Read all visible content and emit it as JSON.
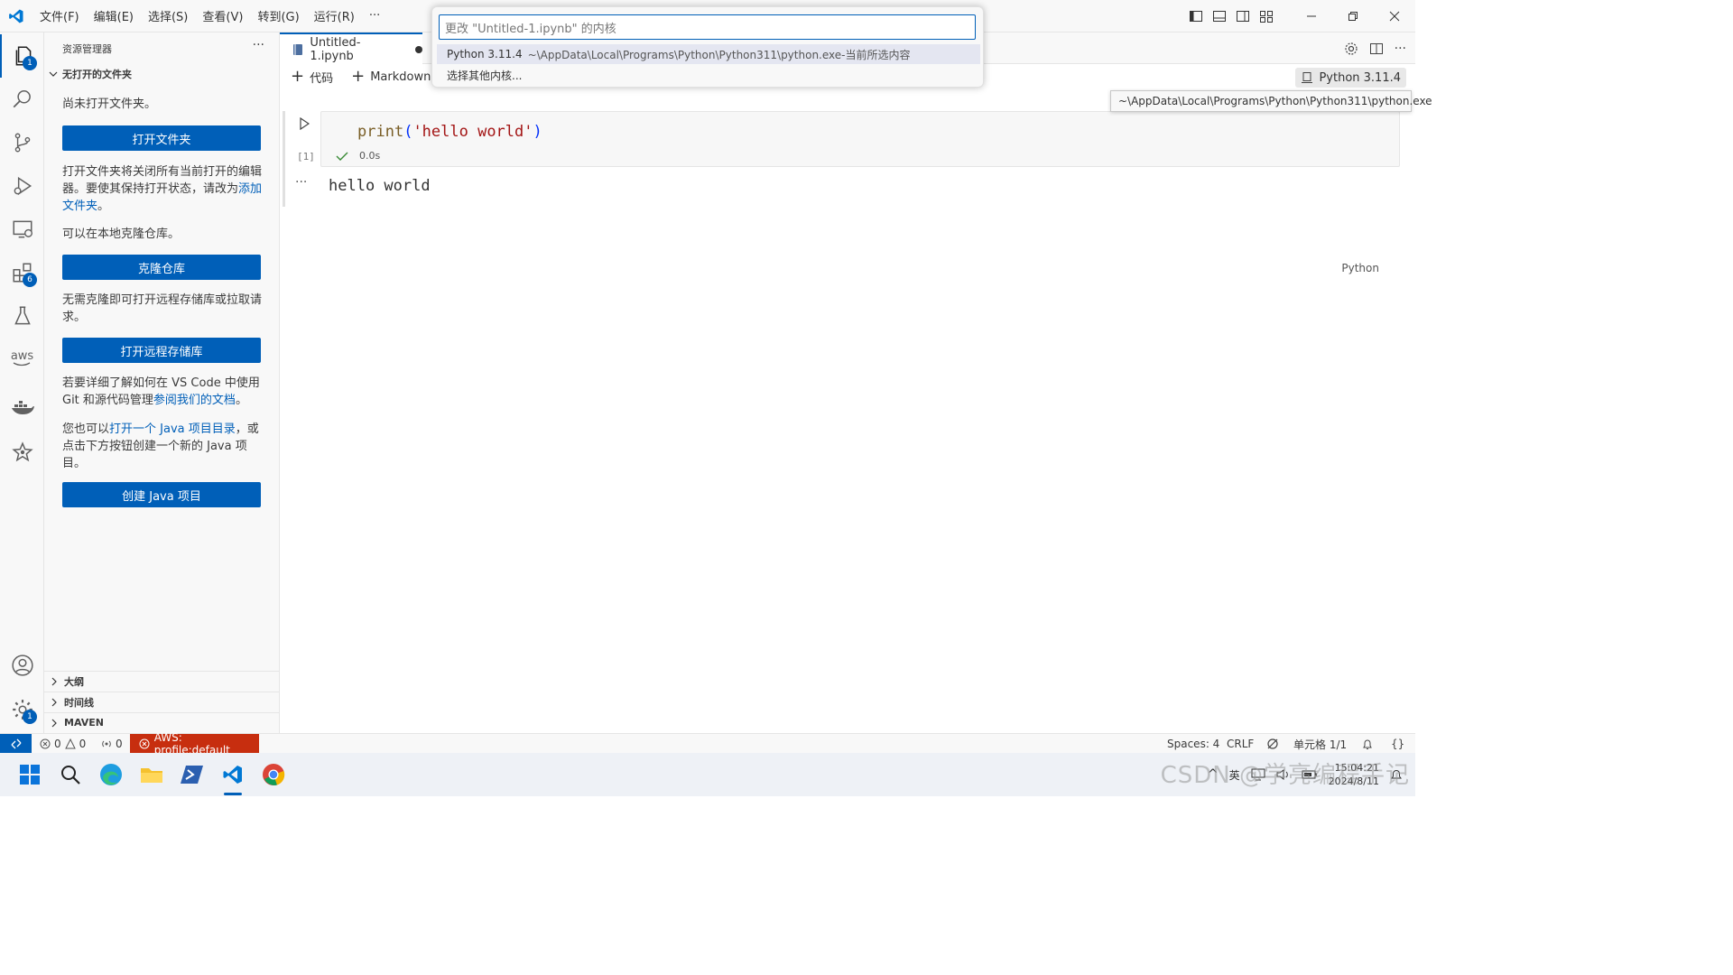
{
  "titlebar": {
    "menu": [
      "文件(F)",
      "编辑(E)",
      "选择(S)",
      "查看(V)",
      "转到(G)",
      "运行(R)",
      "···"
    ]
  },
  "activity": {
    "explorer_badge": "1",
    "extensions_badge": "6",
    "settings_badge": "1",
    "aws_label": "aws"
  },
  "sidebar": {
    "title": "资源管理器",
    "more": "···",
    "section": "无打开的文件夹",
    "no_folder_text": "尚未打开文件夹。",
    "open_folder_btn": "打开文件夹",
    "open_folder_desc": "打开文件夹将关闭所有当前打开的编辑器。要使其保持打开状态，请改为",
    "add_folder_link": "添加文件夹",
    "period": "。",
    "clone_text": "可以在本地克隆仓库。",
    "clone_btn": "克隆仓库",
    "remote_text": "无需克隆即可打开远程存储库或拉取请求。",
    "remote_btn": "打开远程存储库",
    "learn_text": "若要详细了解如何在 VS Code 中使用 Git 和源代码管理",
    "learn_link": "参阅我们的文档",
    "java_prefix": "您也可以",
    "java_link": "打开一个 Java 项目目录",
    "java_suffix": "，或点击下方按钮创建一个新的 Java 项目。",
    "java_btn": "创建 Java 项目",
    "bottom": [
      "大纲",
      "时间线",
      "MAVEN"
    ]
  },
  "editor": {
    "tab_label": "Untitled-1.ipynb",
    "toolbar_code": "代码",
    "toolbar_markdown": "Markdown",
    "kernel": "Python 3.11.4",
    "cell": {
      "code_fn": "print",
      "code_open": "(",
      "code_str": "'hello world'",
      "code_close": ")",
      "exec_count": "[1]",
      "duration": "0.0s",
      "language": "Python",
      "output": "hello world",
      "output_more": "···"
    }
  },
  "quickpick": {
    "placeholder": "更改 \"Untitled-1.ipynb\" 的内核",
    "items": [
      {
        "label": "Python 3.11.4",
        "desc": "~\\AppData\\Local\\Programs\\Python\\Python311\\python.exe-当前所选内容"
      },
      {
        "label": "选择其他内核...",
        "desc": ""
      }
    ]
  },
  "tooltip": "~\\AppData\\Local\\Programs\\Python\\Python311\\python.exe",
  "statusbar": {
    "errors": "0",
    "warnings": "0",
    "ports": "0",
    "aws": "AWS: profile:default",
    "spaces": "Spaces: 4",
    "eol": "CRLF",
    "cell": "单元格 1/1"
  },
  "taskbar": {
    "time": "15:04:21",
    "date": "2024/8/11",
    "ime": "英",
    "watermark": "CSDN @学亮编程手记"
  }
}
